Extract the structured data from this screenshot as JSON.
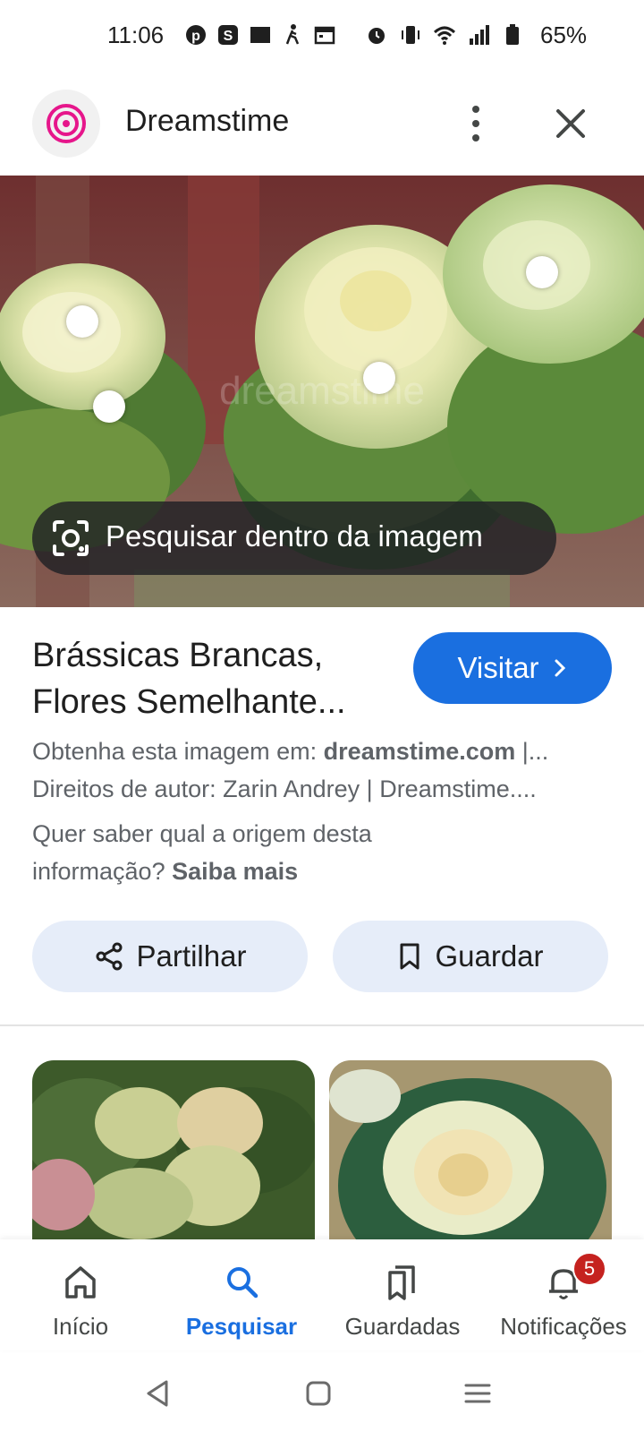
{
  "status_bar": {
    "time": "11:06",
    "battery": "65%",
    "left_icons": [
      "pinterest-icon",
      "s-app-icon",
      "fnac-icon",
      "walking-icon",
      "calendar-icon"
    ],
    "right_icons": [
      "alarm-icon",
      "vibrate-icon",
      "wifi-icon",
      "signal-icon",
      "battery-icon"
    ]
  },
  "header": {
    "site_name": "Dreamstime"
  },
  "hero": {
    "lens_label": "Pesquisar dentro da imagem",
    "watermark": "dreamstime"
  },
  "result": {
    "title_line1": "Brássicas Brancas,",
    "title_line2": "Flores Semelhante...",
    "visit_label": "Visitar",
    "source_prefix": "Obtenha esta imagem em: ",
    "source_domain": "dreamstime.com",
    "source_suffix": " |...",
    "copyright": "Direitos de autor: Zarin Andrey | Dreamstime....",
    "info_prefix_1": "Quer saber qual a origem desta",
    "info_prefix_2": "informação? ",
    "info_link": "Saiba mais"
  },
  "actions": {
    "share_label": "Partilhar",
    "save_label": "Guardar"
  },
  "bottom_nav": {
    "items": [
      {
        "label": "Início",
        "icon": "home-icon"
      },
      {
        "label": "Pesquisar",
        "icon": "search-icon"
      },
      {
        "label": "Guardadas",
        "icon": "bookmarks-icon"
      },
      {
        "label": "Notificações",
        "icon": "bell-icon"
      }
    ],
    "notification_count": "5"
  },
  "colors": {
    "accent": "#1a6fe0",
    "chip_bg": "#e6edf9",
    "badge": "#c5221f"
  }
}
